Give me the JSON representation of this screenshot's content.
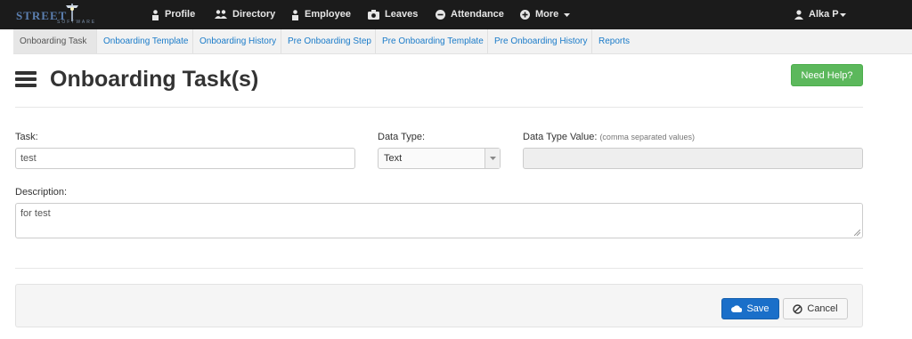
{
  "topbar": {
    "logo_text": "STREET",
    "logo_sub": "SOFTWARE",
    "nav": [
      {
        "label": "Profile",
        "icon": "user-icon"
      },
      {
        "label": "Directory",
        "icon": "users-icon"
      },
      {
        "label": "Employee",
        "icon": "user-icon"
      },
      {
        "label": "Leaves",
        "icon": "camera-icon"
      },
      {
        "label": "Attendance",
        "icon": "minus-circle-icon"
      },
      {
        "label": "More",
        "icon": "plus-circle-icon"
      }
    ],
    "user": "Alka P"
  },
  "subnav": {
    "tabs": [
      {
        "label": "Onboarding Task",
        "active": true
      },
      {
        "label": "Onboarding Template"
      },
      {
        "label": "Onboarding History"
      },
      {
        "label": "Pre Onboarding Step"
      },
      {
        "label": "Pre Onboarding Template"
      },
      {
        "label": "Pre Onboarding History"
      },
      {
        "label": "Reports"
      }
    ]
  },
  "header": {
    "title": "Onboarding Task(s)",
    "help_label": "Need Help?"
  },
  "form": {
    "task_label": "Task:",
    "task_value": "test",
    "data_type_label": "Data Type:",
    "data_type_value": "Text",
    "data_type_value_label": "Data Type Value:",
    "data_type_value_hint": "(comma separated values)",
    "data_type_value_value": "",
    "description_label": "Description:",
    "description_value": "for test"
  },
  "footer": {
    "save_label": "Save",
    "cancel_label": "Cancel"
  },
  "colors": {
    "topbar": "#1b1b1b",
    "link": "#1a7bc9",
    "help": "#5cb85c",
    "save": "#1a6fc9"
  }
}
